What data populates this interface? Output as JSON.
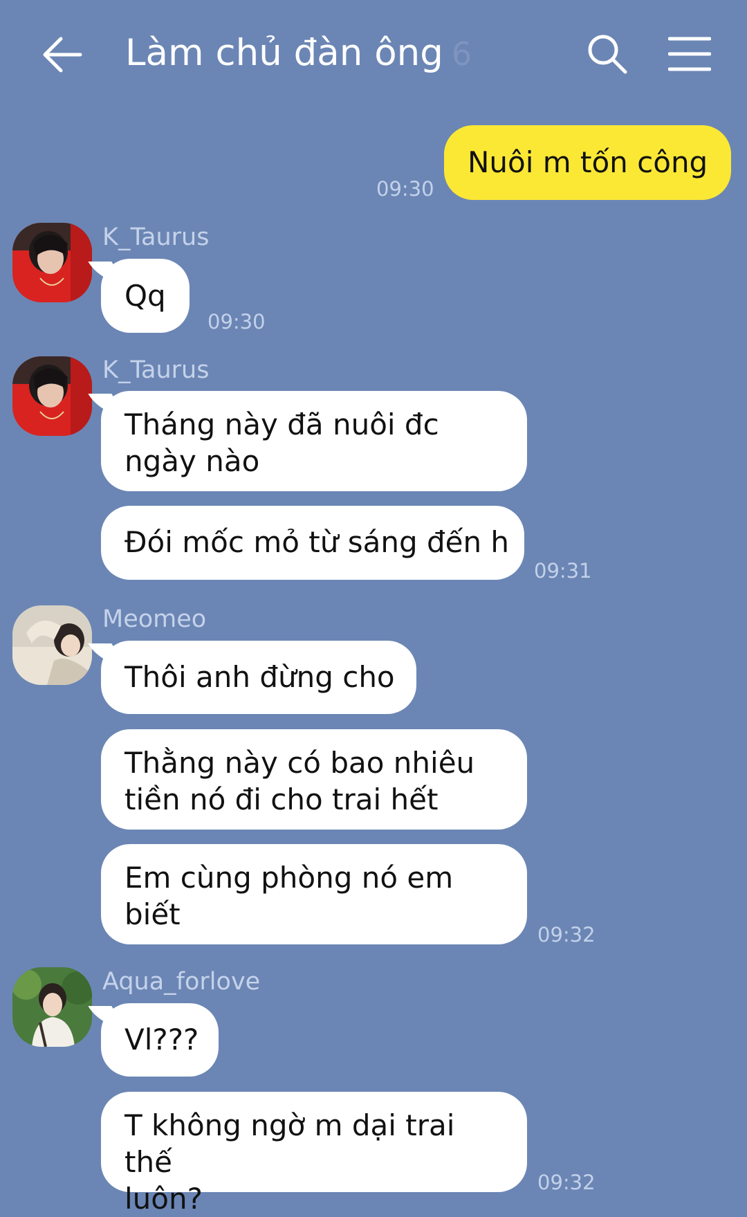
{
  "header": {
    "title": "Làm chủ đàn ông",
    "member_count": "6",
    "back_icon": "arrow-left-icon",
    "search_icon": "search-icon",
    "menu_icon": "hamburger-menu-icon"
  },
  "messages": [
    {
      "sender": "",
      "text": "Nuôi m tốn công",
      "time": "09:30"
    },
    {
      "sender": "K_Taurus",
      "text": "Qq",
      "time": "09:30"
    },
    {
      "sender": "K_Taurus",
      "text": "Tháng này đã nuôi đc\nngày nào",
      "time": ""
    },
    {
      "sender": "",
      "text": "Đói mốc mỏ từ sáng đến h",
      "time": "09:31"
    },
    {
      "sender": "Meomeo",
      "text": "Thôi anh đừng cho",
      "time": ""
    },
    {
      "sender": "",
      "text": "Thằng này có bao nhiêu\ntiền nó đi cho trai hết",
      "time": ""
    },
    {
      "sender": "",
      "text": "Em cùng phòng nó em\nbiết",
      "time": "09:32"
    },
    {
      "sender": "Aqua_forlove",
      "text": "Vl???",
      "time": ""
    },
    {
      "sender": "",
      "text": "T không ngờ m dại trai thế\nluôn?",
      "time": "09:32"
    }
  ],
  "colors": {
    "background": "#6b86b4",
    "my_bubble": "#fbe835",
    "other_bubble": "#ffffff"
  }
}
